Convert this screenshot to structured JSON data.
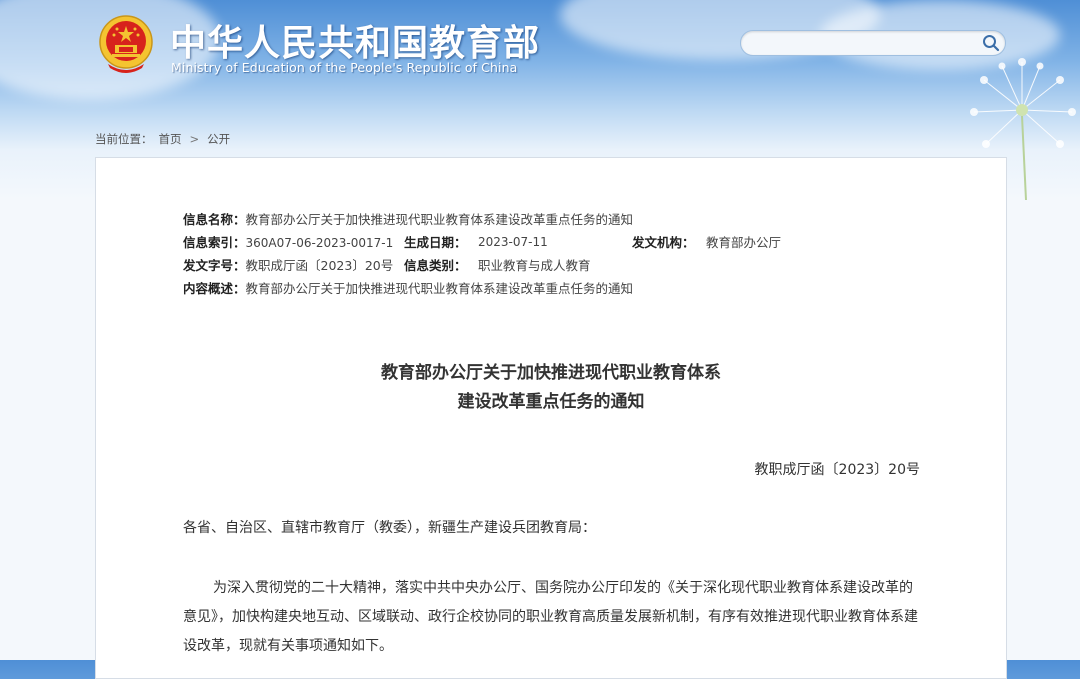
{
  "header": {
    "site_title": "中华人民共和国教育部",
    "site_subtitle": "Ministry of Education of the People's Republic of China",
    "search_placeholder": ""
  },
  "breadcrumb": {
    "label": "当前位置：",
    "items": [
      "首页",
      "公开"
    ],
    "separator": ">"
  },
  "meta": {
    "name_label": "信息名称：",
    "name_value": "教育部办公厅关于加快推进现代职业教育体系建设改革重点任务的通知",
    "index_label": "信息索引：",
    "index_value": "360A07-06-2023-0017-1",
    "date_label": "生成日期：",
    "date_value": "2023-07-11",
    "org_label": "发文机构：",
    "org_value": "教育部办公厅",
    "docno_label": "发文字号：",
    "docno_value": "教职成厅函〔2023〕20号",
    "category_label": "信息类别：",
    "category_value": "职业教育与成人教育",
    "summary_label": "内容概述：",
    "summary_value": "教育部办公厅关于加快推进现代职业教育体系建设改革重点任务的通知"
  },
  "document": {
    "title_line1": "教育部办公厅关于加快推进现代职业教育体系",
    "title_line2": "建设改革重点任务的通知",
    "doc_number": "教职成厅函〔2023〕20号",
    "addressee": "各省、自治区、直辖市教育厅（教委），新疆生产建设兵团教育局：",
    "paragraph1": "为深入贯彻党的二十大精神，落实中共中央办公厅、国务院办公厅印发的《关于深化现代职业教育体系建设改革的意见》，加快构建央地互动、区域联动、政行企校协同的职业教育高质量发展新机制，有序有效推进现代职业教育体系建设改革，现就有关事项通知如下。"
  },
  "colors": {
    "header_blue": "#4f8fd6",
    "emblem_red": "#d7231c",
    "emblem_gold": "#f4c431",
    "panel_border": "#d6dde6"
  }
}
